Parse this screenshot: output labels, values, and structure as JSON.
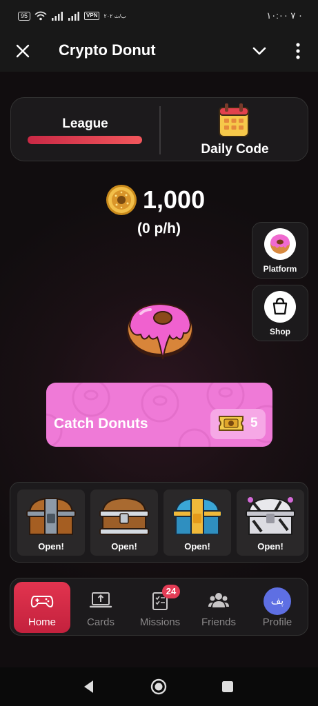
{
  "status_bar": {
    "battery": "95",
    "vpn": "VPN",
    "small_text": "۲۰۲ ب/ث",
    "time": "۱۰:۰۰ ۷ ۰"
  },
  "header": {
    "title": "Crypto Donut",
    "close_icon": "close-icon",
    "menu_icon": "chevron-down-icon",
    "more_icon": "more-vertical-icon"
  },
  "top_card": {
    "league_label": "League",
    "league_progress": 1.0,
    "daily_code_label": "Daily Code"
  },
  "balance": {
    "amount": "1,000",
    "rate": "(0 p/h)"
  },
  "side_buttons": {
    "platform_label": "Platform",
    "shop_label": "Shop"
  },
  "catch": {
    "label": "Catch Donuts",
    "tickets": "5"
  },
  "chests": [
    {
      "label": "Open!",
      "variant": "wood-iron"
    },
    {
      "label": "Open!",
      "variant": "wood-silver"
    },
    {
      "label": "Open!",
      "variant": "blue-gold"
    },
    {
      "label": "Open!",
      "variant": "silver-zebra"
    }
  ],
  "nav": {
    "items": [
      {
        "label": "Home",
        "icon": "gamepad-icon",
        "active": true
      },
      {
        "label": "Cards",
        "icon": "laptop-upload-icon"
      },
      {
        "label": "Missions",
        "icon": "tasks-icon",
        "badge": "24"
      },
      {
        "label": "Friends",
        "icon": "users-icon"
      },
      {
        "label": "Profile",
        "icon": "avatar",
        "avatar_text": "پف"
      }
    ]
  },
  "colors": {
    "accent_pink": "#ef7ad7",
    "accent_red": "#e2344f",
    "background": "#0f0c0e",
    "avatar_blue": "#5e6fe3"
  }
}
